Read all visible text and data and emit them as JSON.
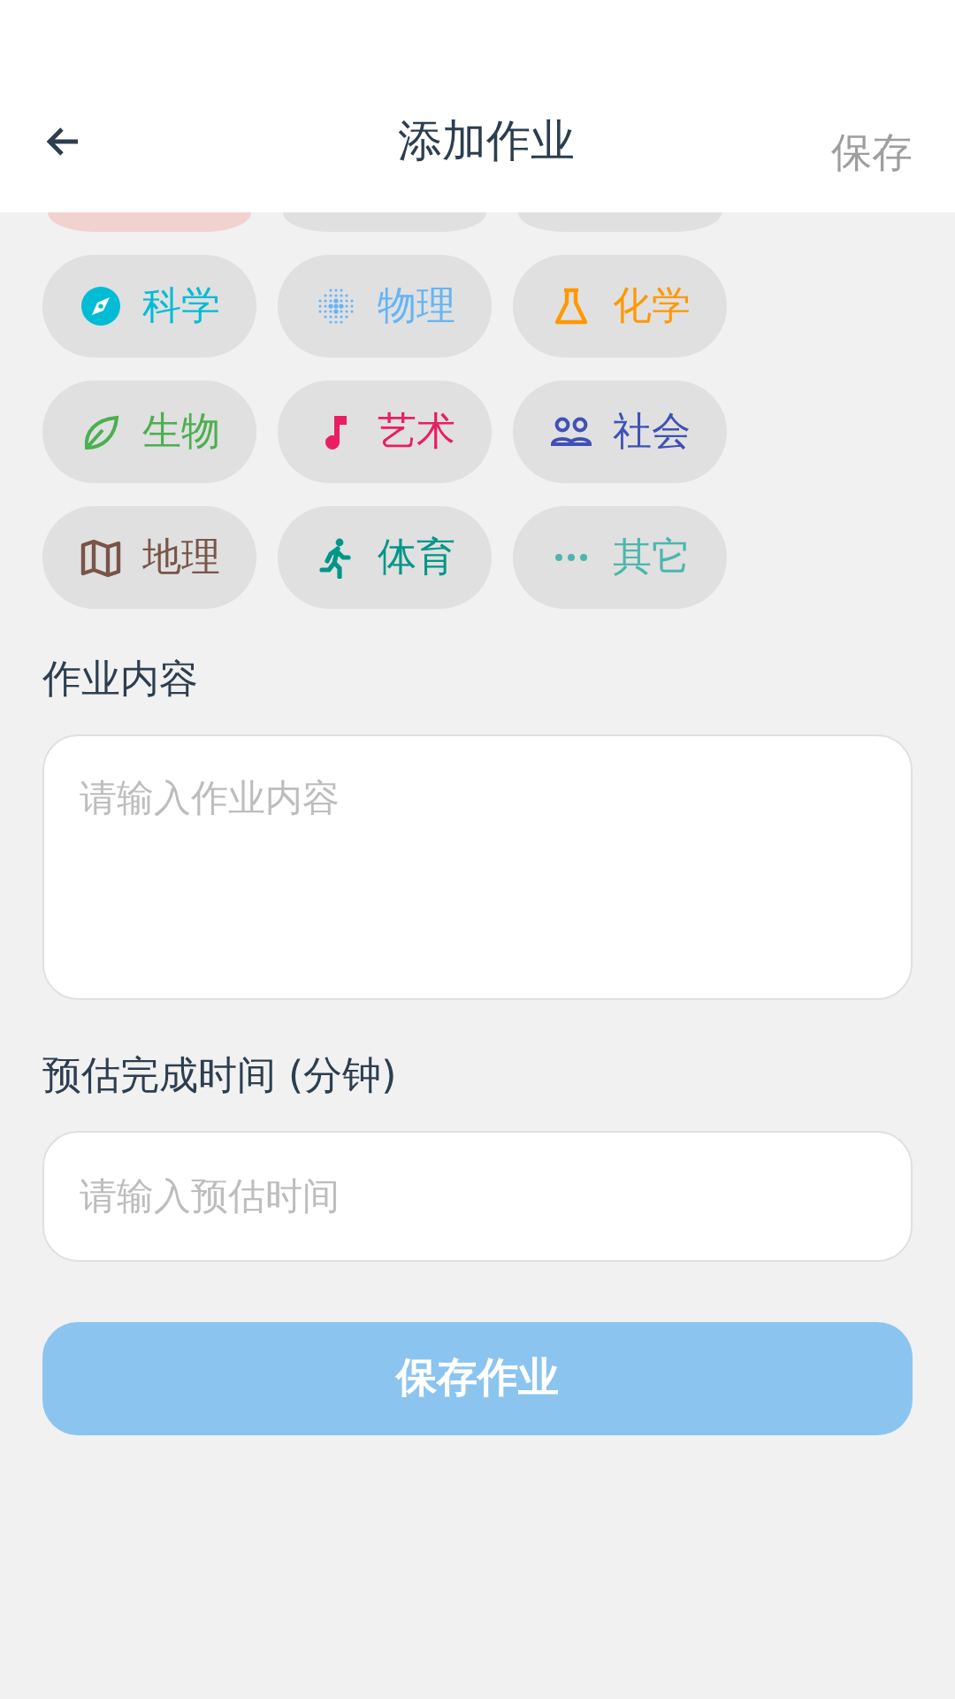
{
  "header": {
    "title": "添加作业",
    "action": "保存"
  },
  "partial_chips": [
    {
      "color": "#f2d2cf"
    },
    {
      "color": "#e0e0e0"
    },
    {
      "color": "#e0e0e0"
    }
  ],
  "subjects": [
    {
      "label": "科学",
      "kind": "compass",
      "color": "#00bcd4",
      "selected": false
    },
    {
      "label": "物理",
      "kind": "dots",
      "color": "#64b5f6",
      "selected": false
    },
    {
      "label": "化学",
      "kind": "flask",
      "color": "#ff9800",
      "selected": false
    },
    {
      "label": "生物",
      "kind": "leaf",
      "color": "#4caf50",
      "selected": false
    },
    {
      "label": "艺术",
      "kind": "note",
      "color": "#e91e63",
      "selected": false
    },
    {
      "label": "社会",
      "kind": "people",
      "color": "#3f51b5",
      "selected": false
    },
    {
      "label": "地理",
      "kind": "map",
      "color": "#795548",
      "selected": false
    },
    {
      "label": "体育",
      "kind": "runner",
      "color": "#009688",
      "selected": false
    },
    {
      "label": "其它",
      "kind": "more",
      "color": "#4db6ac",
      "selected": false
    }
  ],
  "content": {
    "label": "作业内容",
    "placeholder": "请输入作业内容"
  },
  "time": {
    "label": "预估完成时间 (分钟)",
    "placeholder": "请输入预估时间"
  },
  "submit": "保存作业"
}
